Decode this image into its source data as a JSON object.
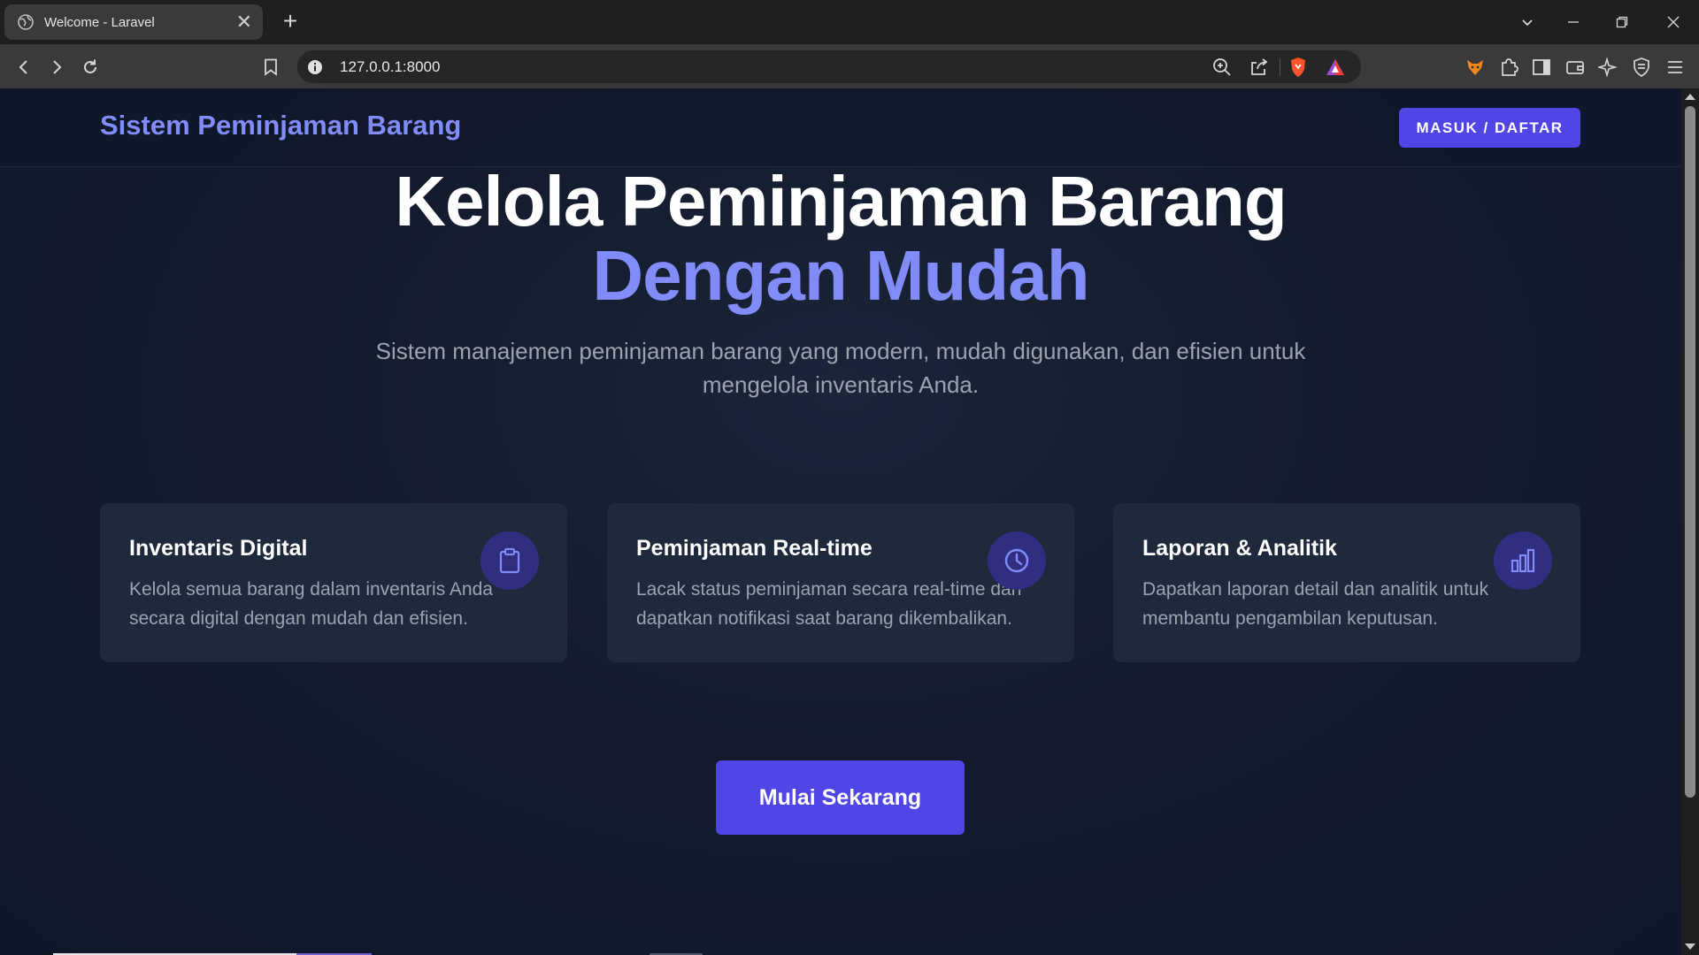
{
  "browser": {
    "tab_title": "Welcome - Laravel",
    "tab_close": "✕",
    "new_tab": "+",
    "url": "127.0.0.1:8000"
  },
  "header": {
    "brand": "Sistem Peminjaman Barang",
    "login_button": "MASUK / DAFTAR"
  },
  "hero": {
    "title_line1": "Kelola Peminjaman Barang",
    "title_line2": "Dengan Mudah",
    "subtitle": "Sistem manajemen peminjaman barang yang modern, mudah digunakan, dan efisien untuk mengelola inventaris Anda."
  },
  "features": [
    {
      "title": "Inventaris Digital",
      "description": "Kelola semua barang dalam inventaris Anda secara digital dengan mudah dan efisien.",
      "icon": "clipboard-icon"
    },
    {
      "title": "Peminjaman Real-time",
      "description": "Lacak status peminjaman secara real-time dan dapatkan notifikasi saat barang dikembalikan.",
      "icon": "clock-icon"
    },
    {
      "title": "Laporan & Analitik",
      "description": "Dapatkan laporan detail dan analitik untuk membantu pengambilan keputusan.",
      "icon": "bar-chart-icon"
    }
  ],
  "cta": {
    "label": "Mulai Sekarang"
  },
  "colors": {
    "accent": "#818cf8",
    "button": "#4f46e5",
    "background": "#0f172a",
    "card": "#1e293b",
    "icon_circle": "#312e81",
    "muted_text": "#9ca3af"
  }
}
